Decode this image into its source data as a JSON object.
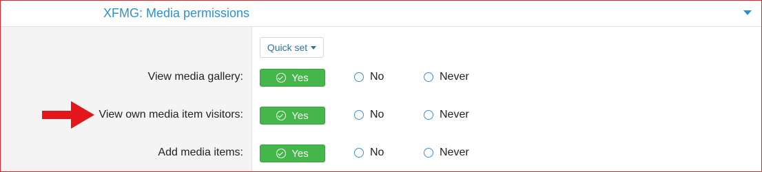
{
  "section": {
    "title": "XFMG: Media permissions"
  },
  "quick_set": {
    "label": "Quick set"
  },
  "rows": [
    {
      "label": "View media gallery:",
      "selected": "Yes"
    },
    {
      "label": "View own media item visitors:",
      "selected": "Yes"
    },
    {
      "label": "Add media items:",
      "selected": "Yes"
    }
  ],
  "options": {
    "yes": "Yes",
    "no": "No",
    "never": "Never"
  },
  "colors": {
    "accent_blue": "#2f8fd1",
    "yes_green": "#45b649",
    "annotation_arrow": "#e3161c",
    "frame_border": "#d9262b"
  },
  "icons": {
    "toggle": "caret-down-icon",
    "yes": "check-circle-icon",
    "annotation": "red-arrow-icon"
  }
}
